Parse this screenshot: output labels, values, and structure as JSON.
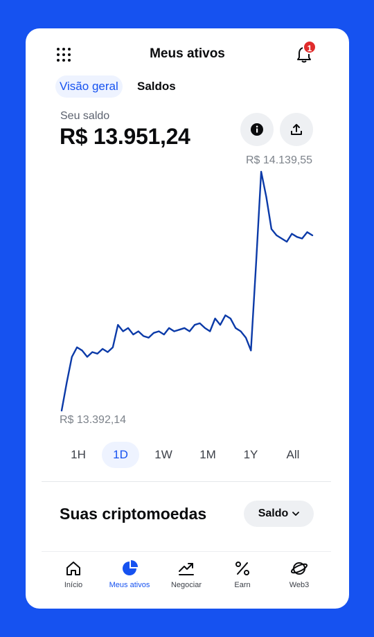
{
  "header": {
    "title": "Meus ativos",
    "notification_count": "1"
  },
  "tabs": [
    {
      "label": "Visão geral"
    },
    {
      "label": "Saldos"
    }
  ],
  "balance": {
    "label": "Seu saldo",
    "value": "R$ 13.951,24"
  },
  "chart_data": {
    "type": "line",
    "max_label": "R$ 14.139,55",
    "min_label": "R$ 13.392,14",
    "series": [
      {
        "values": [
          13392,
          13480,
          13560,
          13590,
          13580,
          13560,
          13575,
          13570,
          13585,
          13575,
          13590,
          13660,
          13640,
          13650,
          13630,
          13640,
          13625,
          13620,
          13635,
          13640,
          13630,
          13650,
          13640,
          13645,
          13650,
          13640,
          13660,
          13665,
          13650,
          13640,
          13680,
          13660,
          13690,
          13680,
          13650,
          13640,
          13620,
          13580,
          13850,
          14139,
          14060,
          13960,
          13940,
          13930,
          13920,
          13945,
          13935,
          13930,
          13950,
          13940
        ]
      }
    ],
    "color": "#0b3aa8"
  },
  "ranges": [
    {
      "label": "1H"
    },
    {
      "label": "1D"
    },
    {
      "label": "1W"
    },
    {
      "label": "1M"
    },
    {
      "label": "1Y"
    },
    {
      "label": "All"
    }
  ],
  "active_range": "1D",
  "section": {
    "title": "Suas criptomoedas",
    "sort_label": "Saldo"
  },
  "nav": [
    {
      "label": "Início",
      "icon": "home-icon"
    },
    {
      "label": "Meus ativos",
      "icon": "pie-chart-icon"
    },
    {
      "label": "Negociar",
      "icon": "trend-icon"
    },
    {
      "label": "Earn",
      "icon": "percent-icon"
    },
    {
      "label": "Web3",
      "icon": "planet-icon"
    }
  ],
  "colors": {
    "accent": "#1652f0",
    "background": "#1652f0"
  }
}
